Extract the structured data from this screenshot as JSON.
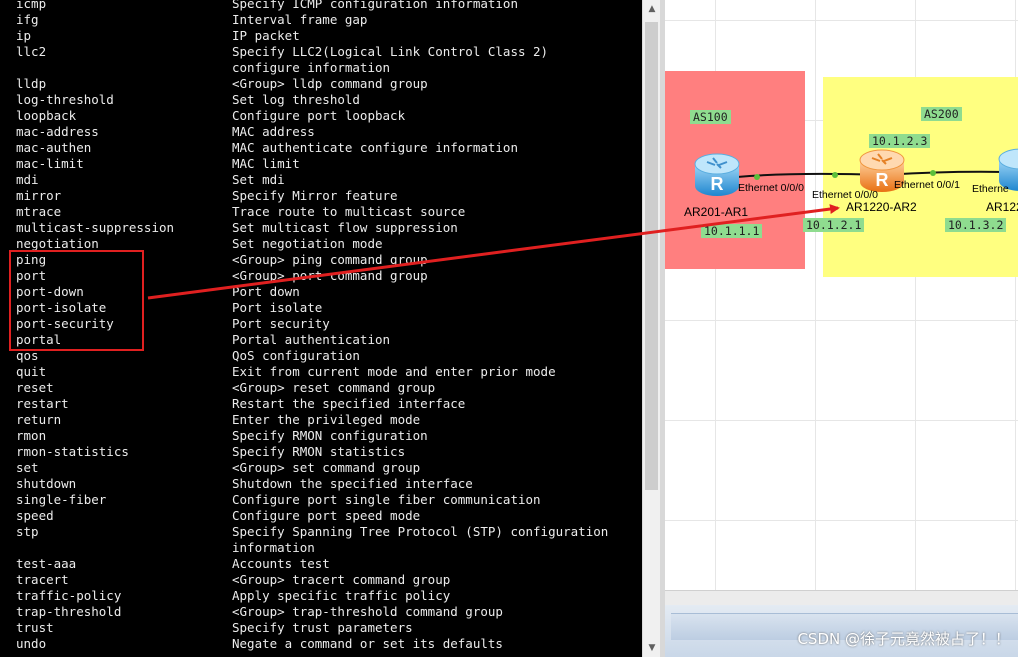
{
  "terminal": {
    "lines": [
      {
        "cmd": "icmp",
        "desc": "Specify ICMP configuration information"
      },
      {
        "cmd": "ifg",
        "desc": "Interval frame gap"
      },
      {
        "cmd": "ip",
        "desc": "IP packet"
      },
      {
        "cmd": "llc2",
        "desc": "Specify LLC2(Logical Link Control Class 2)"
      },
      {
        "cmd": "",
        "desc": "configure information"
      },
      {
        "cmd": "lldp",
        "desc": "<Group> lldp command group"
      },
      {
        "cmd": "log-threshold",
        "desc": "Set log threshold"
      },
      {
        "cmd": "loopback",
        "desc": "Configure port loopback"
      },
      {
        "cmd": "mac-address",
        "desc": "MAC address"
      },
      {
        "cmd": "mac-authen",
        "desc": "MAC authenticate configure information"
      },
      {
        "cmd": "mac-limit",
        "desc": "MAC limit"
      },
      {
        "cmd": "mdi",
        "desc": "Set mdi"
      },
      {
        "cmd": "mirror",
        "desc": "Specify Mirror feature"
      },
      {
        "cmd": "mtrace",
        "desc": "Trace route to multicast source"
      },
      {
        "cmd": "multicast-suppression",
        "desc": "Set multicast flow suppression"
      },
      {
        "cmd": "negotiation",
        "desc": "Set negotiation mode"
      },
      {
        "cmd": "ping",
        "desc": "<Group> ping command group"
      },
      {
        "cmd": "port",
        "desc": "<Group> port command group"
      },
      {
        "cmd": "port-down",
        "desc": "Port down"
      },
      {
        "cmd": "port-isolate",
        "desc": "Port isolate"
      },
      {
        "cmd": "port-security",
        "desc": "Port security"
      },
      {
        "cmd": "portal",
        "desc": "Portal authentication"
      },
      {
        "cmd": "qos",
        "desc": "QoS configuration"
      },
      {
        "cmd": "quit",
        "desc": "Exit from current mode and enter prior mode"
      },
      {
        "cmd": "reset",
        "desc": "<Group> reset command group"
      },
      {
        "cmd": "restart",
        "desc": "Restart the specified interface"
      },
      {
        "cmd": "return",
        "desc": "Enter the privileged mode"
      },
      {
        "cmd": "rmon",
        "desc": "Specify RMON configuration"
      },
      {
        "cmd": "rmon-statistics",
        "desc": "Specify RMON statistics"
      },
      {
        "cmd": "set",
        "desc": "<Group> set command group"
      },
      {
        "cmd": "shutdown",
        "desc": "Shutdown the specified interface"
      },
      {
        "cmd": "single-fiber",
        "desc": "Configure port single fiber communication"
      },
      {
        "cmd": "speed",
        "desc": "Configure port speed mode"
      },
      {
        "cmd": "stp",
        "desc": "Specify Spanning Tree Protocol (STP) configuration"
      },
      {
        "cmd": "",
        "desc": "information"
      },
      {
        "cmd": "test-aaa",
        "desc": "Accounts test"
      },
      {
        "cmd": "tracert",
        "desc": "<Group> tracert command group"
      },
      {
        "cmd": "traffic-policy",
        "desc": "Apply specific traffic policy"
      },
      {
        "cmd": "trap-threshold",
        "desc": "<Group> trap-threshold command group"
      },
      {
        "cmd": "trust",
        "desc": "Specify trust parameters"
      },
      {
        "cmd": "undo",
        "desc": "Negate a command or set its defaults"
      }
    ]
  },
  "topology": {
    "as100": {
      "label": "AS100",
      "color": "#ff7f7f"
    },
    "as200": {
      "label": "AS200",
      "color": "#ffff80"
    },
    "ar1": {
      "name": "AR201-AR1",
      "port": "Ethernet 0/0/0",
      "ip": "10.1.1.1",
      "color": "#3fa9e8"
    },
    "ar2": {
      "name": "AR1220-AR2",
      "port_left": "Ethernet 0/0/0",
      "port_right": "Ethernet 0/0/1",
      "ip_top": "10.1.2.3",
      "ip_bottom": "10.1.2.1",
      "color": "#f28a2e"
    },
    "ar3": {
      "name": "AR122",
      "port": "Etherne",
      "ip": "10.1.3.2",
      "color": "#3fa9e8"
    }
  },
  "annotation": {
    "color": "#e02020"
  },
  "watermark": "CSDN @徐子元竟然被占了！！"
}
